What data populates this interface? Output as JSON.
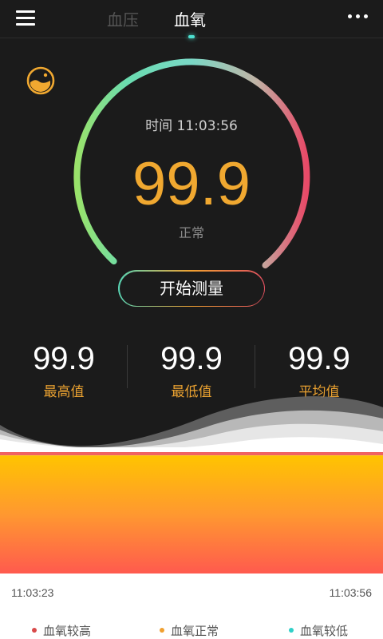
{
  "header": {
    "tabs": [
      {
        "label": "血压",
        "active": false
      },
      {
        "label": "血氧",
        "active": true
      }
    ]
  },
  "gauge": {
    "time_label": "时间 11:03:56",
    "reading": "99.9",
    "status": "正常",
    "start_button": "开始测量"
  },
  "stats": [
    {
      "value": "99.9",
      "label": "最高值"
    },
    {
      "value": "99.9",
      "label": "最低值"
    },
    {
      "value": "99.9",
      "label": "平均值"
    }
  ],
  "chart_data": {
    "type": "area",
    "x": [
      "11:03:23",
      "11:03:56"
    ],
    "series": [
      {
        "values": [
          99.9,
          99.9
        ]
      }
    ],
    "legend": [
      {
        "label": "血氧较高",
        "color": "#d84a4a"
      },
      {
        "label": "血氧正常",
        "color": "#f0a030"
      },
      {
        "label": "血氧较低",
        "color": "#30d0c8"
      }
    ]
  },
  "icons": {
    "menu": "menu-icon",
    "more": "more-icon",
    "history": "history-icon"
  },
  "colors": {
    "reading": "#f0a830",
    "accent_teal": "#4de0d0",
    "stat_label": "#e8a030"
  }
}
